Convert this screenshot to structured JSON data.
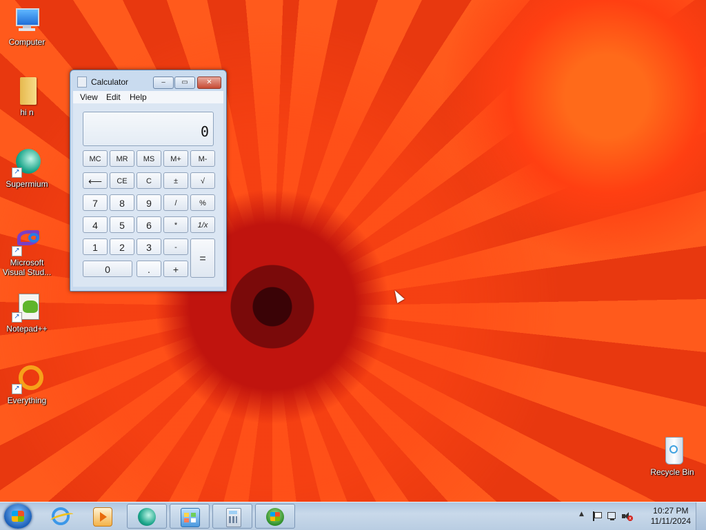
{
  "desktop": {
    "icons": [
      {
        "label": "Computer",
        "icon": "computer-icon"
      },
      {
        "label": "hi n",
        "icon": "folder-icon"
      },
      {
        "label": "Supermium",
        "icon": "supermium-icon"
      },
      {
        "label": "Microsoft Visual Stud...",
        "icon": "visual-studio-icon"
      },
      {
        "label": "Notepad++",
        "icon": "notepad-plus-plus-icon"
      },
      {
        "label": "Everything",
        "icon": "everything-icon"
      },
      {
        "label": "Recycle Bin",
        "icon": "recycle-bin-icon"
      }
    ]
  },
  "calculator": {
    "title": "Calculator",
    "window_buttons": {
      "minimize": "‒",
      "maximize": "▭",
      "close": "✕"
    },
    "menu": [
      "View",
      "Edit",
      "Help"
    ],
    "display": "0",
    "buttons": {
      "mc": "MC",
      "mr": "MR",
      "ms": "MS",
      "mplus": "M+",
      "mminus": "M-",
      "back": "⟵",
      "ce": "CE",
      "c": "C",
      "plusminus": "±",
      "sqrt": "√",
      "n7": "7",
      "n8": "8",
      "n9": "9",
      "divide": "/",
      "percent": "%",
      "n4": "4",
      "n5": "5",
      "n6": "6",
      "multiply": "*",
      "reciprocal": "1/x",
      "n1": "1",
      "n2": "2",
      "n3": "3",
      "minus": "-",
      "equals": "=",
      "n0": "0",
      "dot": ".",
      "plus": "+"
    }
  },
  "taskbar": {
    "start_icon": "windows-start-icon",
    "pinned": [
      {
        "name": "internet-explorer-icon",
        "open": false
      },
      {
        "name": "media-player-icon",
        "open": false
      },
      {
        "name": "supermium-icon",
        "open": true
      },
      {
        "name": "control-panel-icon",
        "open": true
      },
      {
        "name": "calculator-icon",
        "open": true
      },
      {
        "name": "windows-app-icon",
        "open": true
      }
    ],
    "tray": {
      "chevron": "▲",
      "icons": [
        "action-center-flag-icon",
        "network-icon",
        "volume-muted-icon"
      ]
    },
    "clock": {
      "time": "10:27 PM",
      "date": "11/11/2024"
    }
  },
  "colors": {
    "wallpaper": "#ef4a12",
    "taskbar": "#c9d9ea",
    "window": "#c9dbef"
  }
}
